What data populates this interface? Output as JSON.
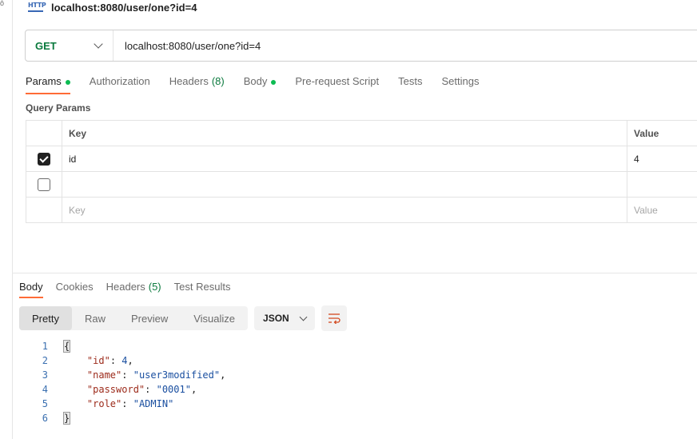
{
  "request": {
    "title": "localhost:8080/user/one?id=4",
    "method": "GET",
    "url": "localhost:8080/user/one?id=4",
    "badge": "HTTP"
  },
  "req_tabs": [
    {
      "label": "Params",
      "dot": true
    },
    {
      "label": "Authorization"
    },
    {
      "label": "Headers",
      "count": "(8)"
    },
    {
      "label": "Body",
      "dot": true
    },
    {
      "label": "Pre-request Script"
    },
    {
      "label": "Tests"
    },
    {
      "label": "Settings"
    }
  ],
  "query": {
    "section_label": "Query Params",
    "headers": {
      "key": "Key",
      "value": "Value"
    },
    "rows": [
      {
        "checked": true,
        "key": "id",
        "value": "4"
      },
      {
        "checked": false,
        "key": "",
        "value": ""
      }
    ],
    "placeholder": {
      "key": "Key",
      "value": "Value"
    }
  },
  "response": {
    "tabs": [
      {
        "label": "Body"
      },
      {
        "label": "Cookies"
      },
      {
        "label": "Headers",
        "count": "(5)"
      },
      {
        "label": "Test Results"
      }
    ],
    "view_modes": [
      "Pretty",
      "Raw",
      "Preview",
      "Visualize"
    ],
    "format": "JSON",
    "body": {
      "line_numbers": [
        "1",
        "2",
        "3",
        "4",
        "5",
        "6"
      ],
      "open": "{",
      "close": "}",
      "fields": [
        {
          "key": "\"id\"",
          "value": "4",
          "sep": ","
        },
        {
          "key": "\"name\"",
          "value": "\"user3modified\"",
          "sep": ","
        },
        {
          "key": "\"password\"",
          "value": "\"0001\"",
          "sep": ","
        },
        {
          "key": "\"role\"",
          "value": "\"ADMIN\"",
          "sep": ""
        }
      ]
    }
  },
  "colors": {
    "accent": "#ff6c37",
    "method_get": "#0b7a3e",
    "dot": "#0cbb52"
  }
}
